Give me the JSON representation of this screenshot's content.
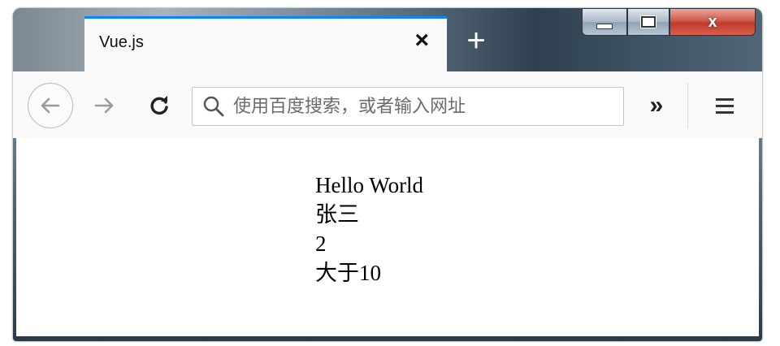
{
  "tab": {
    "title": "Vue.js",
    "close_label": "×",
    "new_tab_label": "+"
  },
  "window_controls": {
    "minimize": "minimize",
    "maximize": "maximize",
    "close_label": "x"
  },
  "navbar": {
    "back_icon": "back-arrow-icon",
    "forward_icon": "forward-arrow-icon",
    "reload_icon": "reload-icon",
    "search_placeholder": "使用百度搜索，或者输入网址",
    "search_value": "",
    "overflow_label": "»",
    "menu_icon": "hamburger-menu-icon"
  },
  "content": {
    "lines": [
      "Hello World",
      "张三",
      "2",
      "大于10"
    ]
  },
  "colors": {
    "tab_accent": "#0a84ff",
    "close_button": "#c13a2c"
  }
}
